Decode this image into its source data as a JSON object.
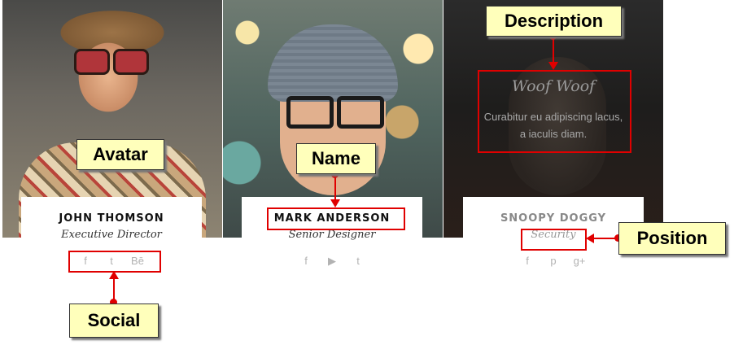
{
  "cards": [
    {
      "name": "JOHN THOMSON",
      "position": "Executive Director",
      "social": [
        "f",
        "t",
        "Bē"
      ]
    },
    {
      "name": "MARK ANDERSON",
      "position": "Senior Designer",
      "social": [
        "f",
        "▶",
        "t"
      ]
    },
    {
      "name": "SNOOPY DOGGY",
      "position": "Security",
      "social": [
        "f",
        "p",
        "g+"
      ],
      "description": {
        "title": "Woof Woof",
        "body_line1": "Curabitur eu adipiscing lacus,",
        "body_line2": "a iaculis diam."
      }
    }
  ],
  "annotations": {
    "avatar": "Avatar",
    "name": "Name",
    "description": "Description",
    "position": "Position",
    "social": "Social"
  },
  "colors": {
    "annotation_red": "#e00000",
    "annotation_bg": "#ffffbb"
  }
}
